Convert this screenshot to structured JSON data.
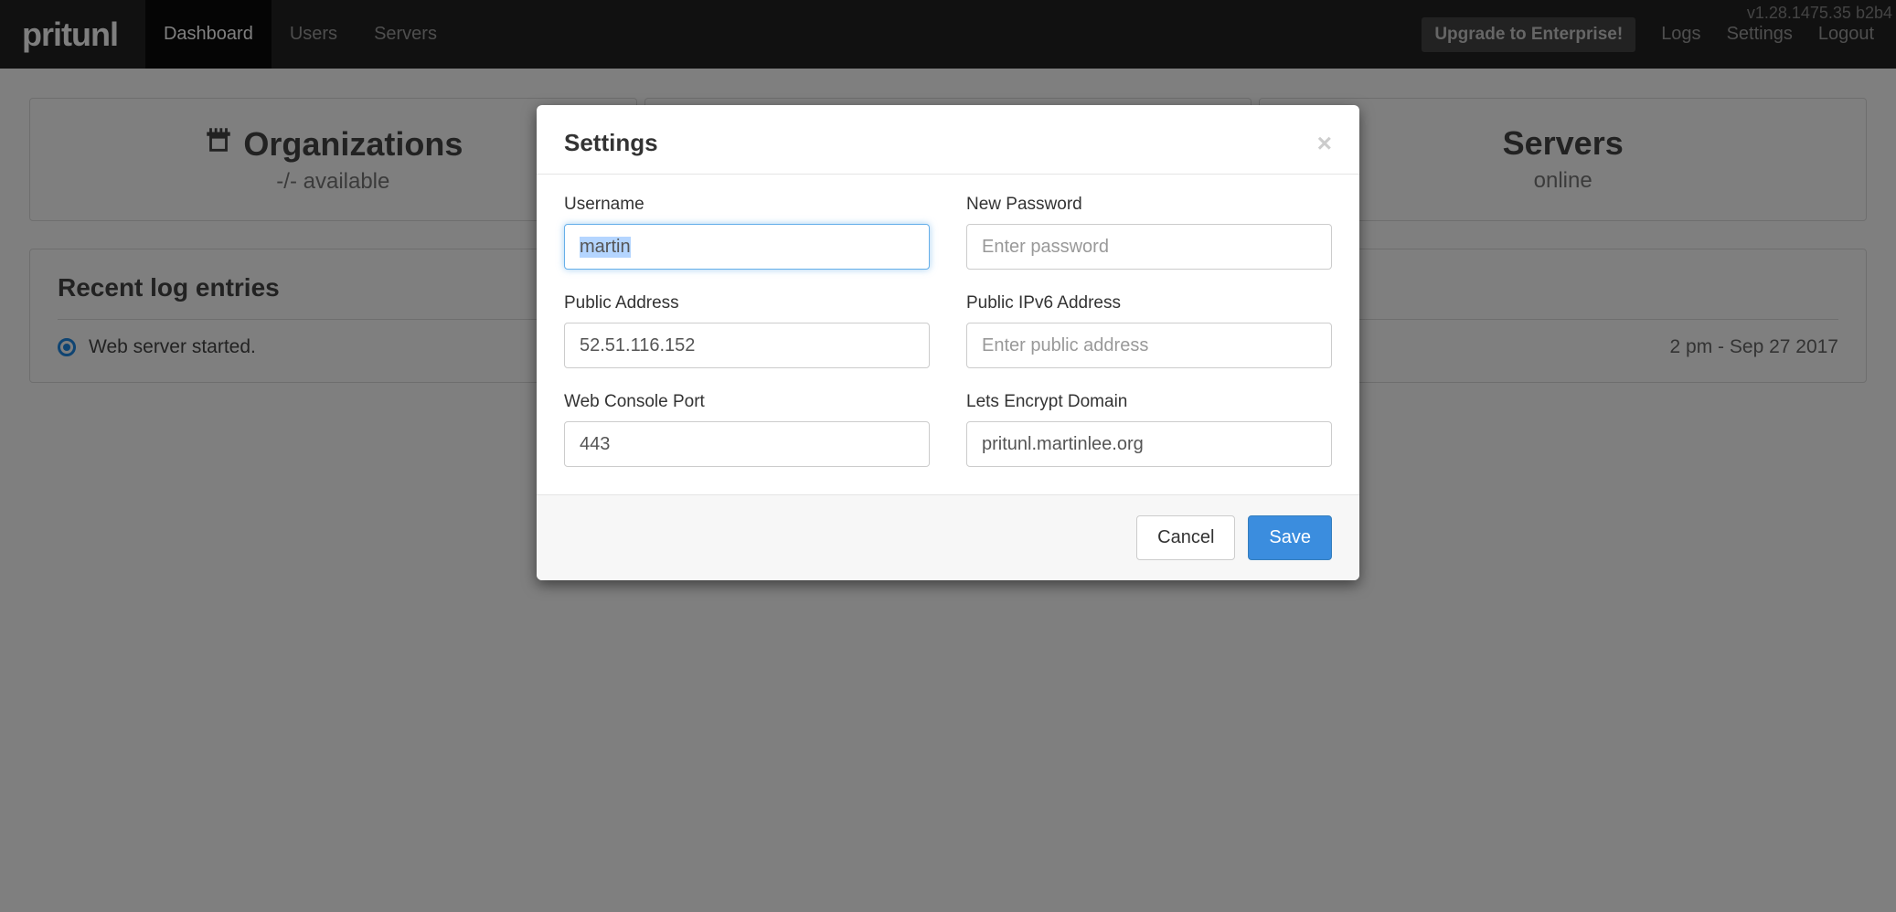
{
  "version": "v1.28.1475.35 b2b4",
  "logo": "pritunl",
  "nav": {
    "dashboard": "Dashboard",
    "users": "Users",
    "servers": "Servers",
    "upgrade": "Upgrade to Enterprise!",
    "logs": "Logs",
    "settings": "Settings",
    "logout": "Logout"
  },
  "cards": {
    "orgs": {
      "title": "Organizations",
      "sub": "-/- available"
    },
    "servers": {
      "title": "Servers",
      "sub": "online"
    }
  },
  "log": {
    "heading": "Recent log entries",
    "entry_text": "Web server started.",
    "entry_ts": "2 pm - Sep 27 2017"
  },
  "modal": {
    "title": "Settings",
    "labels": {
      "username": "Username",
      "new_password": "New Password",
      "public_address": "Public Address",
      "public_ipv6": "Public IPv6 Address",
      "web_port": "Web Console Port",
      "le_domain": "Lets Encrypt Domain"
    },
    "values": {
      "username": "martin",
      "public_address": "52.51.116.152",
      "web_port": "443",
      "le_domain": "pritunl.martinlee.org"
    },
    "placeholders": {
      "password": "Enter password",
      "ipv6": "Enter public address"
    },
    "buttons": {
      "cancel": "Cancel",
      "save": "Save"
    }
  }
}
